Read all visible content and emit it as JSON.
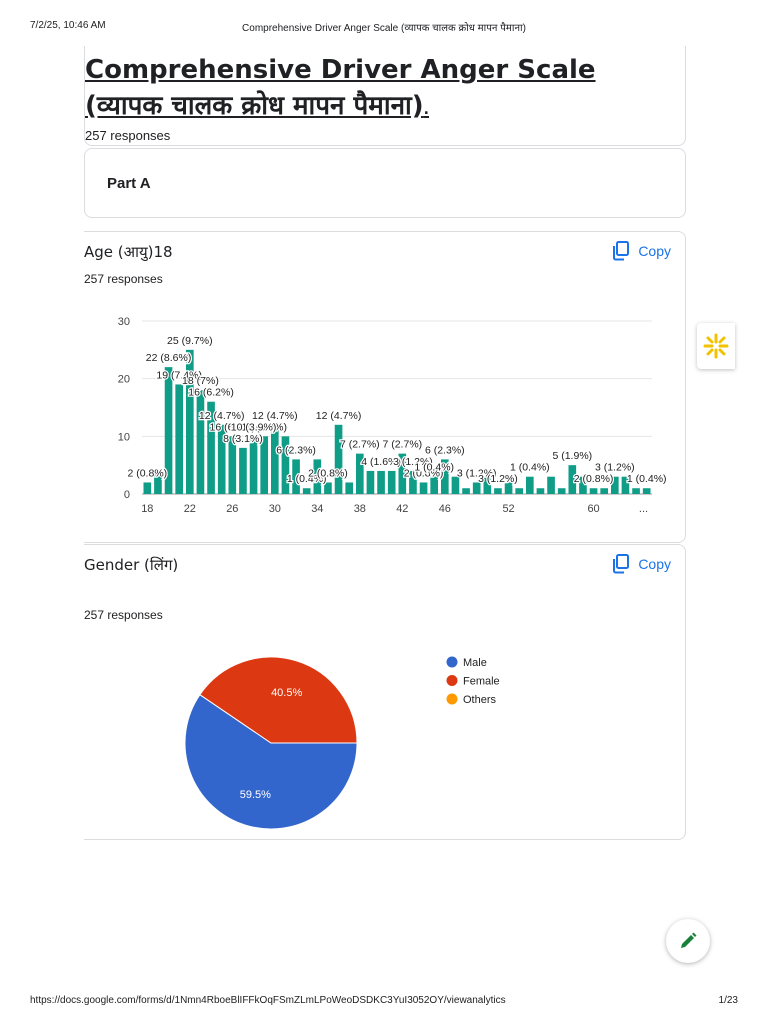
{
  "print": {
    "datetime": "7/2/25, 10:46 AM",
    "doc_title": "Comprehensive Driver Anger Scale (व्यापक चालक क्रोध मापन पैमाना)",
    "url": "https://docs.google.com/forms/d/1Nmn4RboeBlIFFkOqFSmZLmLPoWeoDSDKC3YuI3052OY/viewanalytics",
    "page": "1/23"
  },
  "form": {
    "title_en": "Comprehensive Driver Anger Scale ",
    "title_hi": "(व्यापक चालक क्रोध मापन पैमाना)",
    "title_dot": ".",
    "responses": "257 responses"
  },
  "section": {
    "title": "Part A"
  },
  "copy_label": "Copy",
  "questions": [
    {
      "title": "Age (आयु)18",
      "responses": "257 responses"
    },
    {
      "title": "Gender (लिंग)",
      "responses": "257 responses"
    }
  ],
  "colors": {
    "accent": "#1a73e8",
    "bar": "#0f9d88",
    "male": "#3366cc",
    "female": "#dc3912",
    "others": "#ff9900",
    "fab_pencil": "#188038"
  },
  "icons": {
    "copy": "copy-icon",
    "fab": "pencil-icon",
    "side": "sparkle-icon"
  },
  "chart_data": [
    {
      "type": "bar",
      "x": [
        18,
        19,
        20,
        21,
        22,
        23,
        24,
        25,
        26,
        27,
        28,
        29,
        30,
        31,
        32,
        33,
        34,
        35,
        36,
        37,
        38,
        39,
        40,
        41,
        42,
        43,
        44,
        45,
        46,
        47,
        48,
        49,
        50,
        51,
        52,
        53,
        54,
        55,
        56,
        57,
        58,
        59,
        60,
        61,
        62,
        63,
        64,
        65
      ],
      "values": [
        2,
        4,
        22,
        19,
        25,
        18,
        16,
        12,
        10,
        8,
        10,
        10,
        12,
        10,
        6,
        1,
        6,
        2,
        12,
        2,
        7,
        4,
        4,
        4,
        7,
        4,
        2,
        3,
        6,
        3,
        1,
        2,
        3,
        1,
        2,
        1,
        3,
        1,
        3,
        1,
        5,
        3,
        1,
        1,
        3,
        3,
        1,
        1
      ],
      "x_ticks": [
        "18",
        "22",
        "26",
        "30",
        "34",
        "38",
        "42",
        "46",
        "52",
        "60",
        "..."
      ],
      "ylim": [
        0,
        30
      ],
      "y_ticks": [
        0,
        10,
        20,
        30
      ],
      "data_labels": [
        "2 (0.8%)",
        "22 (8.6%)",
        "25 (9.7%)",
        "19 (7.4%)",
        "18 (7%)",
        "16 (6.2%)",
        "16 (6.2%)",
        "12 (4.7%)",
        "12 (4.7%)",
        "12 (4.7%)",
        "10 (3.9%)",
        "8 (3.1%)",
        "10 (3.9%)",
        "6 (2.3%)",
        "1 (0.4%)",
        "2 (0.8%)",
        "7 (2.7%)",
        "7 (2.7%)",
        "4 (1.6%)",
        "3 (1.2%)",
        "6 (2.3%)",
        "2 (0.8%)",
        "1 (0.4%)",
        "3 (1.2%)",
        "3 (1.2%)",
        "5 (1.9%)",
        "1 (0.4%)",
        "3 (1.2%)",
        "2 (0.8%)",
        "1 (0.4%)"
      ],
      "grid": true,
      "legend": "none"
    },
    {
      "type": "pie",
      "labels": [
        "Male",
        "Female",
        "Others"
      ],
      "values": [
        59.5,
        40.5,
        0
      ],
      "slice_labels": [
        "59.5%",
        "40.5%",
        ""
      ],
      "legend": "right"
    }
  ]
}
